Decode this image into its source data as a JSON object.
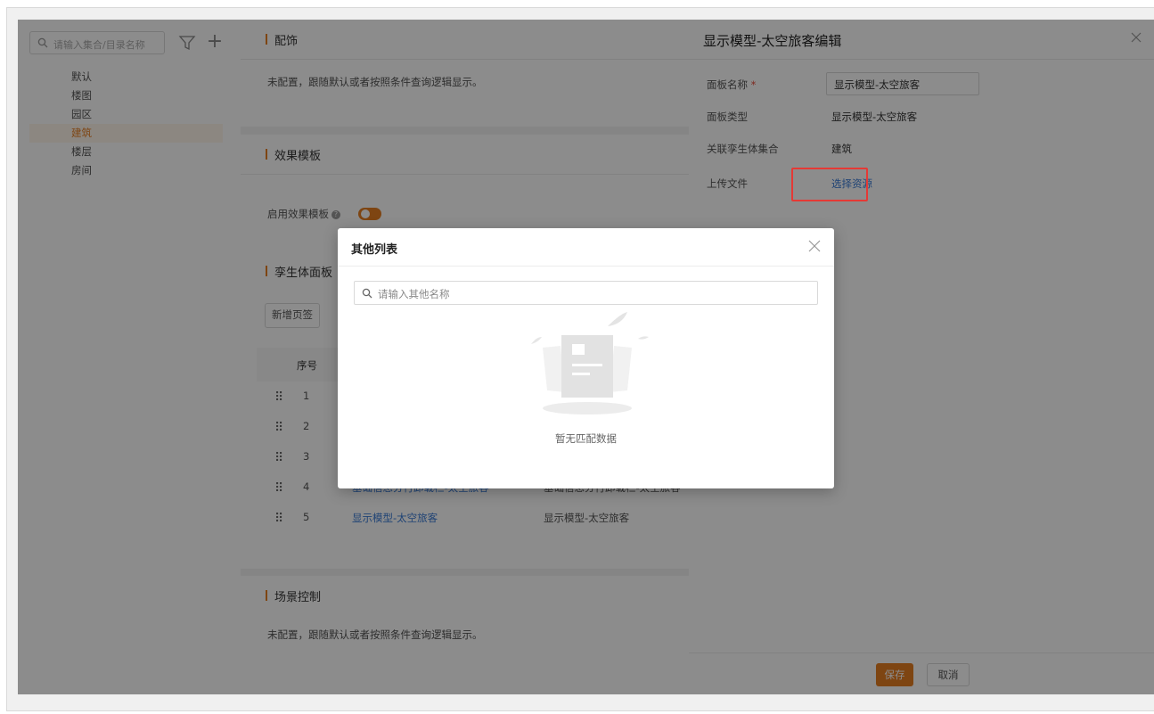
{
  "sidebar": {
    "search_placeholder": "请输入集合/目录名称",
    "items": [
      "默认",
      "楼图",
      "园区",
      "建筑",
      "楼层",
      "房间"
    ],
    "active_index": 3
  },
  "main": {
    "section_config": {
      "title": "配饰",
      "note": "未配置，跟随默认或者按照条件查询逻辑显示。"
    },
    "section_effect": {
      "title": "效果模板",
      "toggle_label": "启用效果模板",
      "toggle_on": true
    },
    "section_twin": {
      "title": "孪生体面板",
      "add_tab_label": "新增页签",
      "column_index": "序号",
      "rows": [
        {
          "index": "1",
          "name": "",
          "type": ""
        },
        {
          "index": "2",
          "name": "",
          "type": ""
        },
        {
          "index": "3",
          "name": "",
          "type": ""
        },
        {
          "index": "4",
          "name": "基础信息分行卸载栏-太空旅客",
          "type": "基础信息分行卸载栏-太空旅客"
        },
        {
          "index": "5",
          "name": "显示模型-太空旅客",
          "type": "显示模型-太空旅客"
        }
      ]
    },
    "section_scene": {
      "title": "场景控制",
      "note": "未配置，跟随默认或者按照条件查询逻辑显示。"
    }
  },
  "drawer": {
    "title": "显示模型-太空旅客编辑",
    "fields": {
      "name_label": "面板名称",
      "name_value": "显示模型-太空旅客",
      "type_label": "面板类型",
      "type_value": "显示模型-太空旅客",
      "collection_label": "关联孪生体集合",
      "collection_value": "建筑",
      "upload_label": "上传文件",
      "upload_link": "选择资源"
    },
    "save_label": "保存",
    "cancel_label": "取消"
  },
  "modal": {
    "title": "其他列表",
    "search_placeholder": "请输入其他名称",
    "empty_text": "暂无匹配数据"
  },
  "colors": {
    "accent": "#e67e22",
    "link": "#3a7bd5",
    "highlight": "#e53935"
  }
}
